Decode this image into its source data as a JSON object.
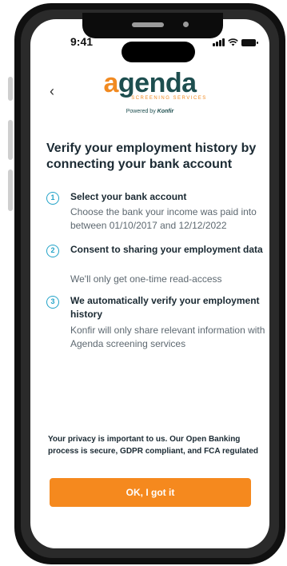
{
  "status_bar": {
    "time": "9:41"
  },
  "header": {
    "back_icon": "chevron-left-icon",
    "logo_text_a": "a",
    "logo_text_rest": "genda",
    "logo_subtitle": "SCREENING SERVICES",
    "powered_by": "Powered by",
    "powered_brand": "Konfir"
  },
  "main": {
    "heading": "Verify your employment history by connecting your bank account",
    "steps": [
      {
        "number": "1",
        "title": "Select your bank account",
        "description": "Choose the bank your income was paid into between 01/10/2017 and 12/12/2022"
      },
      {
        "number": "2",
        "title": "Consent to sharing your employment data",
        "description": "We'll only get one-time read-access"
      },
      {
        "number": "3",
        "title": "We automatically verify your employment history",
        "description": "Konfir will only share relevant information with Agenda screening services"
      }
    ],
    "privacy_note": "Your privacy is important to us. Our Open Banking process is secure, GDPR compliant, and FCA regulated",
    "cta_label": "OK, I got it"
  },
  "colors": {
    "accent_orange": "#f5891e",
    "step_blue": "#23a3c8",
    "logo_teal": "#1d4e4f"
  }
}
